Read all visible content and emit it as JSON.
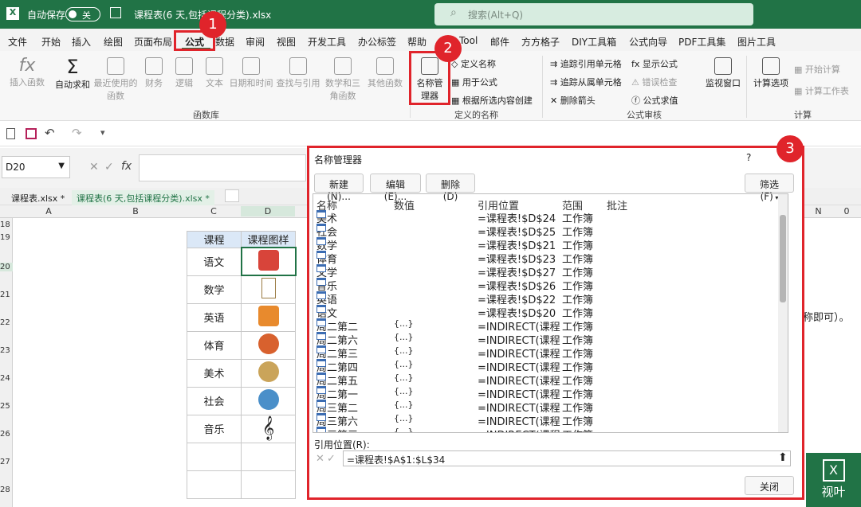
{
  "titlebar": {
    "autosave": "自动保存",
    "toggle": "关",
    "filename": "课程表(6 天,包括课程分类).xlsx",
    "search": "搜索(Alt+Q)"
  },
  "menu": [
    "文件",
    "开始",
    "插入",
    "绘图",
    "页面布局",
    "公式",
    "数据",
    "审阅",
    "视图",
    "开发工具",
    "办公标签",
    "帮助",
    "Tool",
    "邮件",
    "方方格子",
    "DIY工具箱",
    "公式向导",
    "PDF工具集",
    "图片工具"
  ],
  "ribbon": {
    "insert_fn": "插入函数",
    "autosum": "自动求和",
    "recent": "最近使用的函数",
    "finance": "财务",
    "logic": "逻辑",
    "text": "文本",
    "datetime": "日期和时间",
    "lookup": "查找与引用",
    "math": "数学和三角函数",
    "other": "其他函数",
    "group_lib": "函数库",
    "name_mgr": "名称管理器",
    "define_name": "定义名称",
    "use_in": "用于公式",
    "create_sel": "根据所选内容创建",
    "group_names": "定义的名称",
    "trace_prec": "追踪引用单元格",
    "trace_dep": "追踪从属单元格",
    "remove_arrows": "删除箭头",
    "show_formulas": "显示公式",
    "error_check": "错误检查",
    "eval_formula": "公式求值",
    "group_audit": "公式审核",
    "watch": "监视窗口",
    "calc_opts": "计算选项",
    "calc_now": "开始计算",
    "calc_sheet": "计算工作表",
    "group_calc": "计算"
  },
  "namebox": "D20",
  "tabs": [
    "课程表.xlsx *",
    "课程表(6 天,包括课程分类).xlsx *"
  ],
  "sheet": {
    "cols": [
      "A",
      "B",
      "C",
      "D"
    ],
    "rows": [
      "18",
      "19",
      "20",
      "21",
      "22",
      "23",
      "24",
      "25",
      "26",
      "27",
      "28"
    ],
    "header": [
      "课程",
      "课程图样"
    ],
    "courses": [
      "语文",
      "数学",
      "英语",
      "体育",
      "美术",
      "社会",
      "音乐",
      "",
      ""
    ],
    "right_cols": [
      "N",
      "0"
    ],
    "right_text": "名称即可）。"
  },
  "dialog": {
    "title": "名称管理器",
    "help": "?",
    "new": "新建(N)...",
    "edit": "编辑(E)...",
    "delete": "删除(D)",
    "filter": "筛选(F)",
    "cols": [
      "名称",
      "数值",
      "引用位置",
      "范围",
      "批注"
    ],
    "rows": [
      {
        "name": "美术",
        "val": "",
        "ref": "=课程表!$D$24",
        "scope": "工作簿"
      },
      {
        "name": "社会",
        "val": "",
        "ref": "=课程表!$D$25",
        "scope": "工作簿"
      },
      {
        "name": "数学",
        "val": "",
        "ref": "=课程表!$D$21",
        "scope": "工作簿"
      },
      {
        "name": "体育",
        "val": "",
        "ref": "=课程表!$D$23",
        "scope": "工作簿"
      },
      {
        "name": "文学",
        "val": "",
        "ref": "=课程表!$D$27",
        "scope": "工作簿"
      },
      {
        "name": "音乐",
        "val": "",
        "ref": "=课程表!$D$26",
        "scope": "工作簿"
      },
      {
        "name": "英语",
        "val": "",
        "ref": "=课程表!$D$22",
        "scope": "工作簿"
      },
      {
        "name": "语文",
        "val": "",
        "ref": "=课程表!$D$20",
        "scope": "工作簿"
      },
      {
        "name": "周二第二",
        "val": "{...}",
        "ref": "=INDIRECT(课程...",
        "scope": "工作簿"
      },
      {
        "name": "周二第六",
        "val": "{...}",
        "ref": "=INDIRECT(课程...",
        "scope": "工作簿"
      },
      {
        "name": "周二第三",
        "val": "{...}",
        "ref": "=INDIRECT(课程...",
        "scope": "工作簿"
      },
      {
        "name": "周二第四",
        "val": "{...}",
        "ref": "=INDIRECT(课程...",
        "scope": "工作簿"
      },
      {
        "name": "周二第五",
        "val": "{...}",
        "ref": "=INDIRECT(课程...",
        "scope": "工作簿"
      },
      {
        "name": "周二第一",
        "val": "{...}",
        "ref": "=INDIRECT(课程...",
        "scope": "工作簿"
      },
      {
        "name": "周三第二",
        "val": "{...}",
        "ref": "=INDIRECT(课程...",
        "scope": "工作簿"
      },
      {
        "name": "周三第六",
        "val": "{...}",
        "ref": "=INDIRECT(课程...",
        "scope": "工作簿"
      },
      {
        "name": "周三第三",
        "val": "{...}",
        "ref": "=INDIRECT(课程...",
        "scope": "工作簿"
      }
    ],
    "ref_label": "引用位置(R):",
    "ref_value": "=课程表!$A$1:$L$34",
    "close": "关闭"
  },
  "badges": [
    "1",
    "2",
    "3"
  ],
  "watermark": "视叶",
  "colors": {
    "excel_green": "#217346",
    "red": "#e0242b"
  }
}
